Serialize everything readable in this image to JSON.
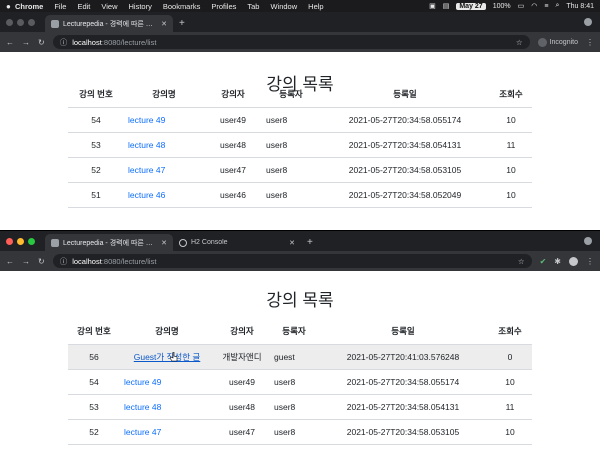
{
  "menubar": {
    "apple": "",
    "items": [
      "Chrome",
      "File",
      "Edit",
      "View",
      "History",
      "Bookmarks",
      "Profiles",
      "Tab",
      "Window",
      "Help"
    ],
    "date": "May 27",
    "battery": "100%",
    "time": "Thu 8:41"
  },
  "top_window": {
    "tab_title": "Lecturepedia - 경력에 따른 난이도",
    "url_host": "localhost",
    "url_path": ":8080/lecture/list",
    "profile_label": "Incognito",
    "page_title": "강의 목록",
    "headers": [
      "강의 번호",
      "강의명",
      "강의자",
      "등록자",
      "등록일",
      "조회수"
    ],
    "rows": [
      {
        "id": "54",
        "name": "lecture 49",
        "lecturer": "user49",
        "registrant": "user8",
        "date": "2021-05-27T20:34:58.055174",
        "views": "10"
      },
      {
        "id": "53",
        "name": "lecture 48",
        "lecturer": "user48",
        "registrant": "user8",
        "date": "2021-05-27T20:34:58.054131",
        "views": "11"
      },
      {
        "id": "52",
        "name": "lecture 47",
        "lecturer": "user47",
        "registrant": "user8",
        "date": "2021-05-27T20:34:58.053105",
        "views": "10"
      },
      {
        "id": "51",
        "name": "lecture 46",
        "lecturer": "user46",
        "registrant": "user8",
        "date": "2021-05-27T20:34:58.052049",
        "views": "10"
      }
    ]
  },
  "bottom_window": {
    "tab1_title": "Lecturepedia - 경력에 따른 난이도",
    "tab2_title": "H2 Console",
    "url_host": "localhost",
    "url_path": ":8080/lecture/list",
    "page_title": "강의 목록",
    "headers": [
      "강의 번호",
      "강의명",
      "강의자",
      "등록자",
      "등록일",
      "조회수"
    ],
    "rows": [
      {
        "id": "56",
        "name": "Guest가 작성한 글",
        "lecturer": "개발자앤디",
        "registrant": "guest",
        "date": "2021-05-27T20:41:03.576248",
        "views": "0"
      },
      {
        "id": "54",
        "name": "lecture 49",
        "lecturer": "user49",
        "registrant": "user8",
        "date": "2021-05-27T20:34:58.055174",
        "views": "10"
      },
      {
        "id": "53",
        "name": "lecture 48",
        "lecturer": "user48",
        "registrant": "user8",
        "date": "2021-05-27T20:34:58.054131",
        "views": "11"
      },
      {
        "id": "52",
        "name": "lecture 47",
        "lecturer": "user47",
        "registrant": "user8",
        "date": "2021-05-27T20:34:58.053105",
        "views": "10"
      }
    ]
  },
  "colors": {
    "link": "#0d6efd",
    "chrome_dark": "#202124",
    "toolbar": "#35363a"
  }
}
